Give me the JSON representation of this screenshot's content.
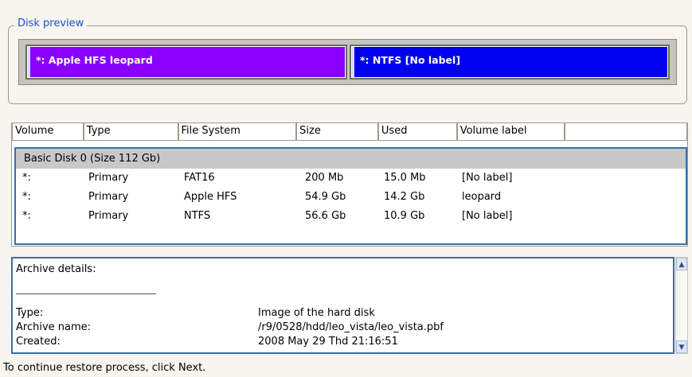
{
  "disk_preview": {
    "title": "Disk preview",
    "partitions": [
      {
        "label": "*: Apple HFS leopard",
        "color": "#8a00ff"
      },
      {
        "label": "*: NTFS [No label]",
        "color": "#0000ee"
      }
    ]
  },
  "volume_table": {
    "columns": [
      "Volume",
      "Type",
      "File System",
      "Size",
      "Used",
      "Volume label"
    ],
    "disk_header": "Basic Disk 0 (Size 112 Gb)",
    "rows": [
      {
        "volume": "*:",
        "type": "Primary",
        "fs": "FAT16",
        "size": "200 Mb",
        "used": "15.0 Mb",
        "label": "[No label]"
      },
      {
        "volume": "*:",
        "type": "Primary",
        "fs": "Apple HFS",
        "size": "54.9 Gb",
        "used": "14.2 Gb",
        "label": "leopard"
      },
      {
        "volume": "*:",
        "type": "Primary",
        "fs": "NTFS",
        "size": "56.6 Gb",
        "used": "10.9 Gb",
        "label": "[No label]"
      }
    ]
  },
  "archive_details": {
    "heading": "Archive details:",
    "fields": [
      {
        "name": "Type:",
        "value": "Image of the hard disk"
      },
      {
        "name": "Archive name:",
        "value": "/r9/0528/hdd/leo_vista/leo_vista.pbf"
      },
      {
        "name": "Created:",
        "value": "2008 May 29 Thd 21:16:51"
      }
    ]
  },
  "status_text": "To continue restore process, click Next.",
  "colors": {
    "accent": "#3a6ea5",
    "group_title": "#1c4fcf"
  }
}
